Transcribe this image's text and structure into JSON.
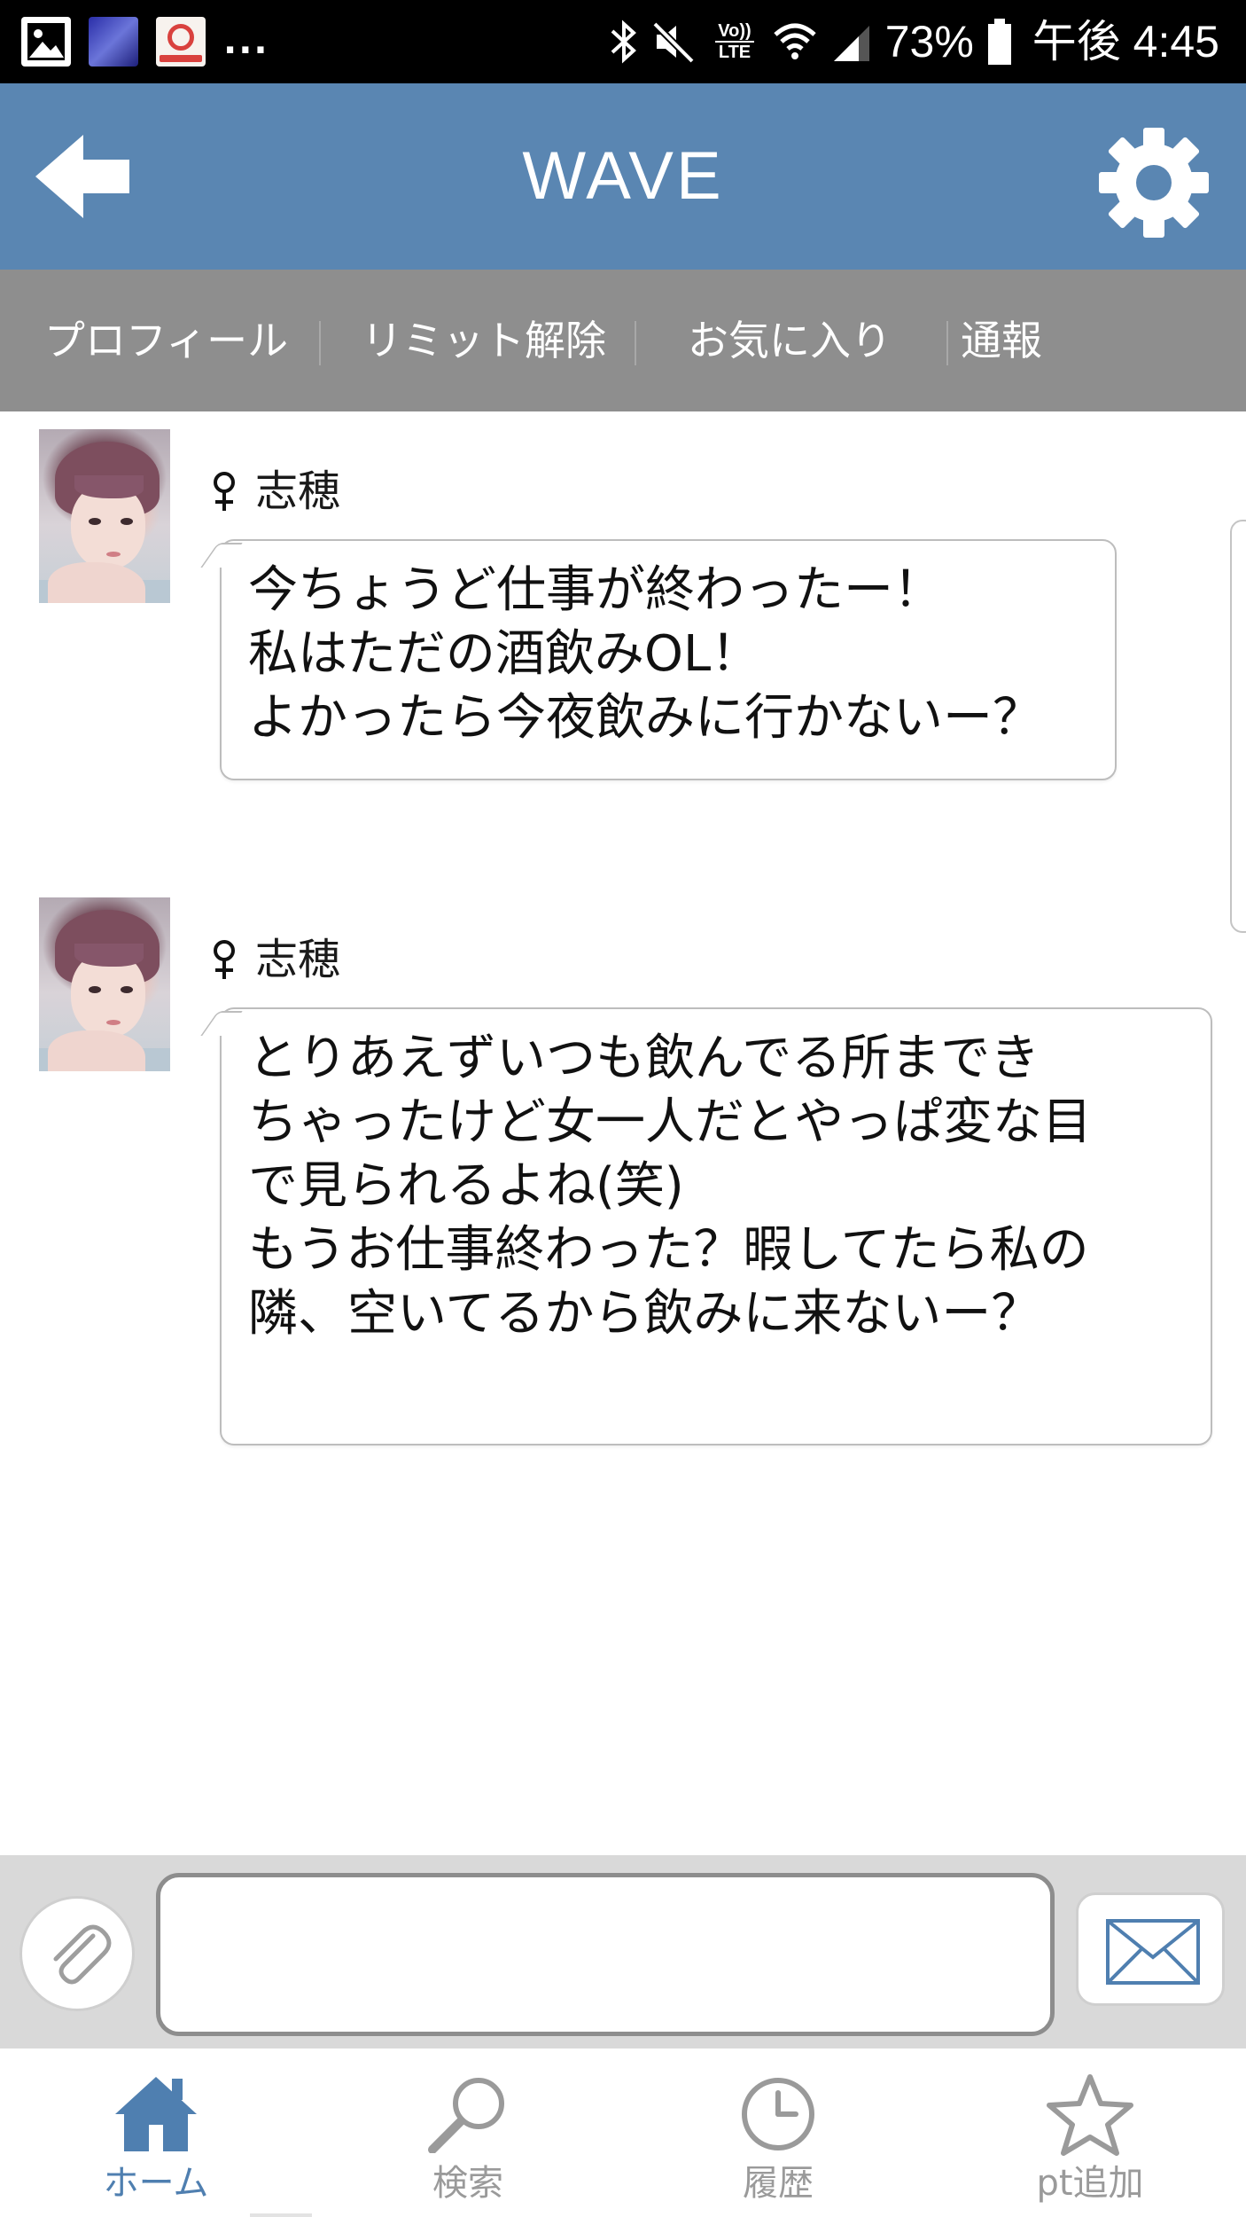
{
  "status_bar": {
    "notification_more": "...",
    "battery_percent": "73%",
    "time": "午後 4:45",
    "network_label_top": "Vo))",
    "network_label_bottom": "LTE"
  },
  "header": {
    "title": "WAVE",
    "back_icon": "arrow-left-icon",
    "settings_icon": "gear-icon",
    "background_color": "#5a86b2"
  },
  "sub_nav": {
    "items": [
      {
        "label": "プロフィール"
      },
      {
        "label": "リミット解除"
      },
      {
        "label": "お気に入り"
      },
      {
        "label": "通報"
      }
    ],
    "background_color": "#8e8e8e"
  },
  "messages": [
    {
      "gender_icon": "female-icon",
      "sender": "志穂",
      "text": "今ちょうど仕事が終わったー！\n私はただの酒飲みOL！\nよかったら今夜飲みに行かないー？"
    },
    {
      "gender_icon": "female-icon",
      "sender": "志穂",
      "text": "とりあえずいつも飲んでる所までき\nちゃったけど女一人だとやっぱ変な目\nで見られるよね(笑)\nもうお仕事終わった？暇してたら私の\n隣、空いてるから飲みに来ないー？"
    }
  ],
  "composer": {
    "attach_icon": "paperclip-icon",
    "input_value": "",
    "send_icon": "envelope-icon"
  },
  "bottom_nav": {
    "tabs": [
      {
        "label": "ホーム",
        "icon": "home-icon",
        "active": true
      },
      {
        "label": "検索",
        "icon": "search-icon",
        "active": false
      },
      {
        "label": "履歴",
        "icon": "clock-icon",
        "active": false
      },
      {
        "label": "pt追加",
        "icon": "star-icon",
        "active": false
      }
    ],
    "active_color": "#4f7fb0",
    "inactive_color": "#9a9a9a"
  }
}
